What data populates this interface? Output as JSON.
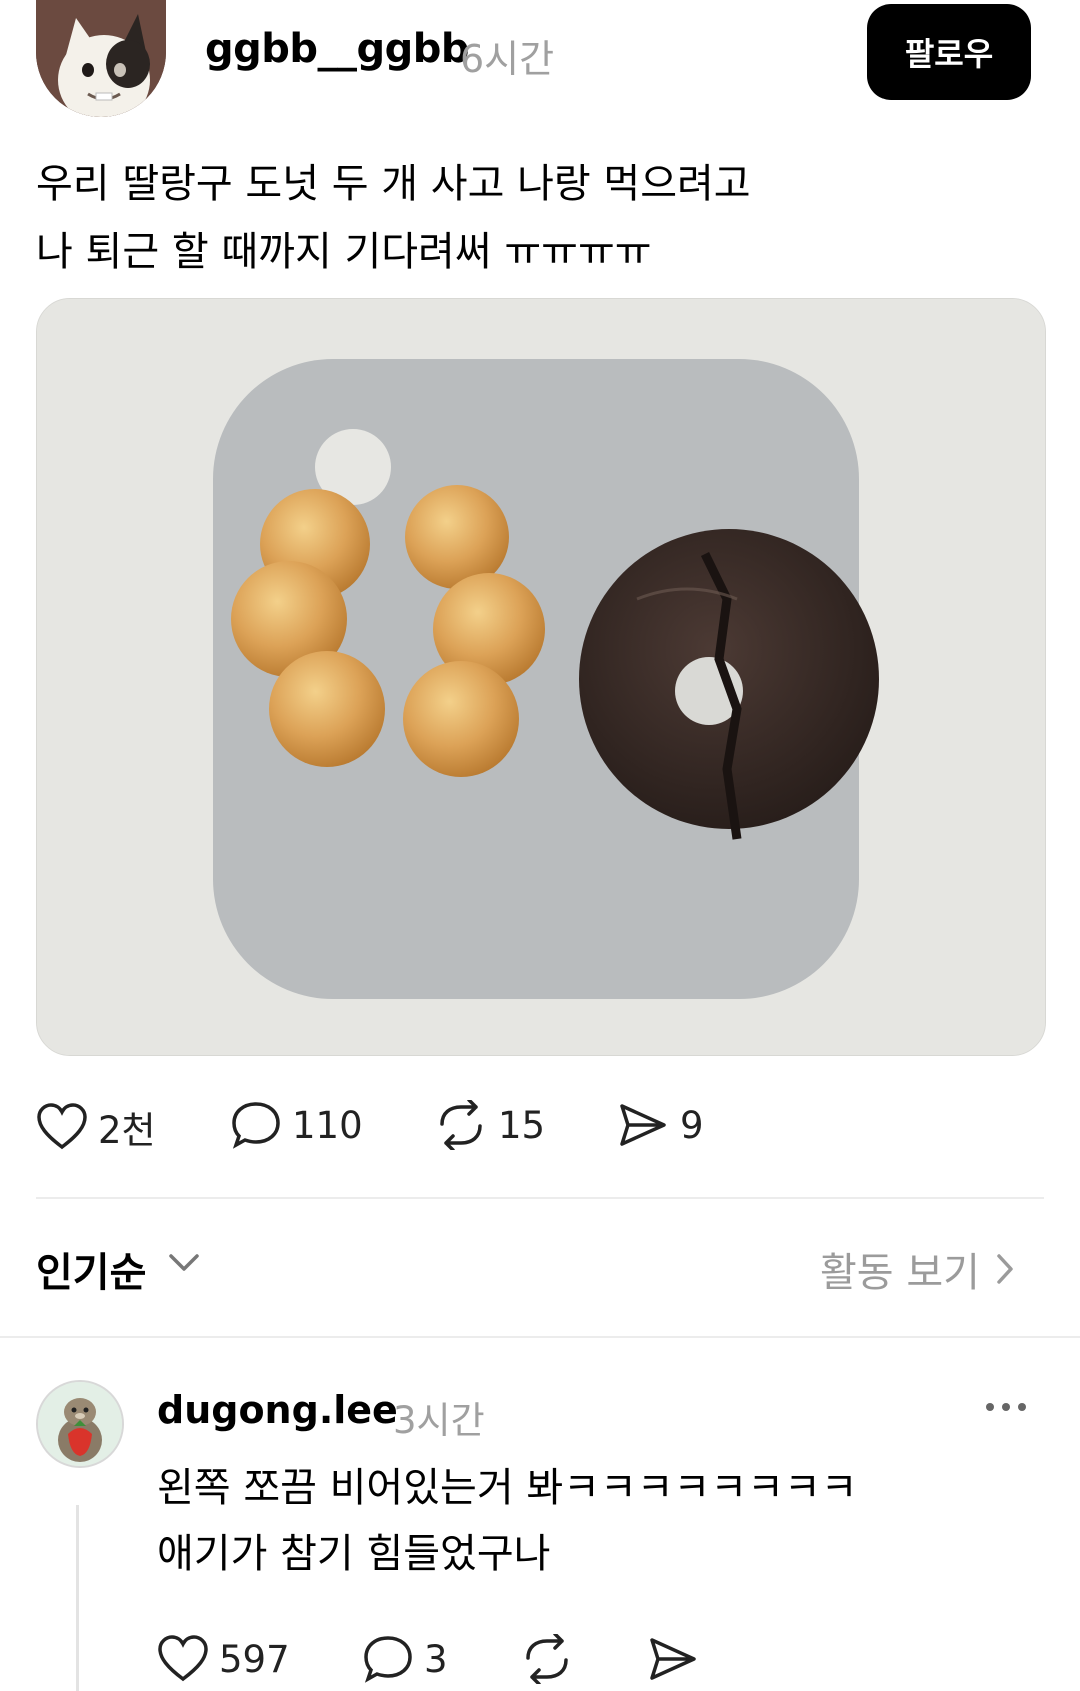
{
  "post": {
    "username": "ggbb__ggbb",
    "time": "6시간",
    "follow_label": "팔로우",
    "text_lines": [
      "우리 딸랑구 도넛 두 개 사고 나랑 먹으려고",
      "나 퇴근 할 때까지 기다려써 ㅠㅠㅠㅠ"
    ],
    "actions": {
      "likes": "2천",
      "comments": "110",
      "reposts": "15",
      "shares": "9"
    }
  },
  "sort": {
    "label": "인기순",
    "activity_label": "활동 보기"
  },
  "comment": {
    "username": "dugong.lee",
    "time": "3시간",
    "text_lines": [
      "왼쪽 쪼끔 비어있는거 봐ㅋㅋㅋㅋㅋㅋㅋㅋ",
      "애기가 참기 힘들었구나"
    ],
    "actions": {
      "likes": "597",
      "comments": "3"
    }
  },
  "icons": [
    "avatar-cat",
    "heart-icon",
    "comment-icon",
    "repost-icon",
    "share-icon",
    "chevron-down-icon",
    "chevron-right-icon",
    "more-icon"
  ]
}
